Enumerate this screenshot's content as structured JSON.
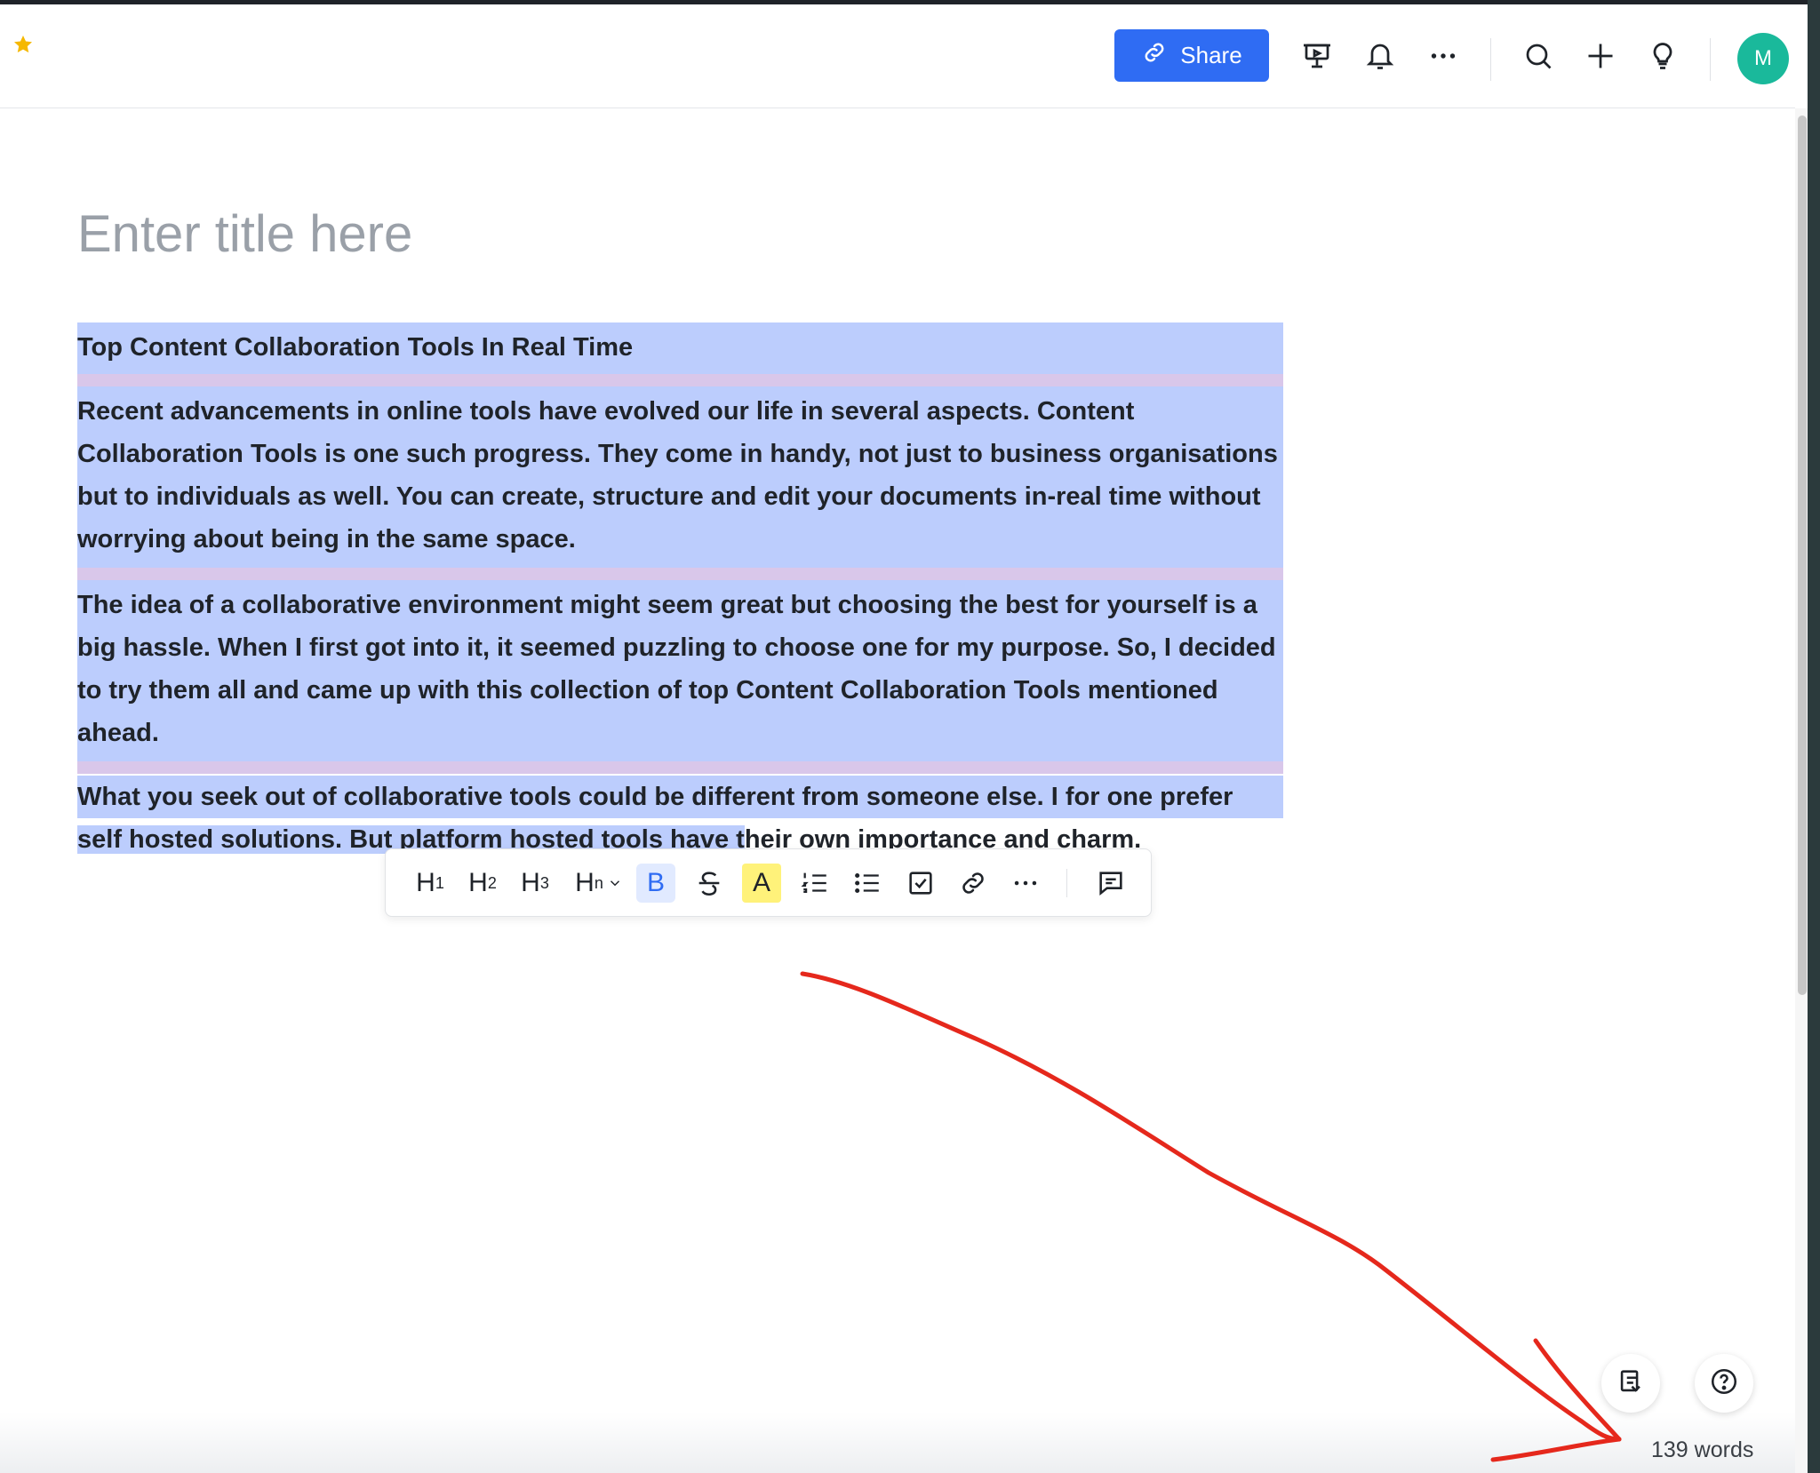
{
  "header": {
    "share_label": "Share",
    "avatar_initial": "M",
    "icons": [
      "star-icon",
      "link-icon",
      "presentation-icon",
      "bell-icon",
      "more-icon",
      "search-icon",
      "plus-icon",
      "lightbulb-icon"
    ]
  },
  "document": {
    "title_placeholder": "Enter title here",
    "paragraphs": [
      "Top Content Collaboration Tools In Real Time",
      "Recent advancements in online tools have evolved our life in several aspects. Content Collaboration Tools is one such progress. They come in handy, not just to business organisations but to individuals as well. You can create, structure and edit your documents in-real time without worrying about being in the same space.",
      "The idea of a collaborative environment might seem great but choosing the best for yourself is a big hassle. When I first got into it, it seemed puzzling to choose one for my purpose. So, I decided to try them all and came up with this collection of top Content Collaboration Tools mentioned ahead."
    ],
    "last_paragraph": {
      "highlighted_line1": "What you seek out of collaborative tools could be different from someone else. I for one prefer",
      "highlighted_line2": "self hosted solutions. But platform hosted tools have t",
      "rest_line2": "heir own importance and charm."
    }
  },
  "toolbar": {
    "h1": "H",
    "h1_sub": "1",
    "h2": "H",
    "h2_sub": "2",
    "h3": "H",
    "h3_sub": "3",
    "hn": "H",
    "hn_sub": "n",
    "bold": "B",
    "highlight": "A"
  },
  "footer": {
    "word_count": "139 words"
  },
  "colors": {
    "accent": "#2f6cf3",
    "selection": "#bccdfd",
    "avatar": "#1ab99b",
    "annotation_arrow": "#e5281c"
  }
}
